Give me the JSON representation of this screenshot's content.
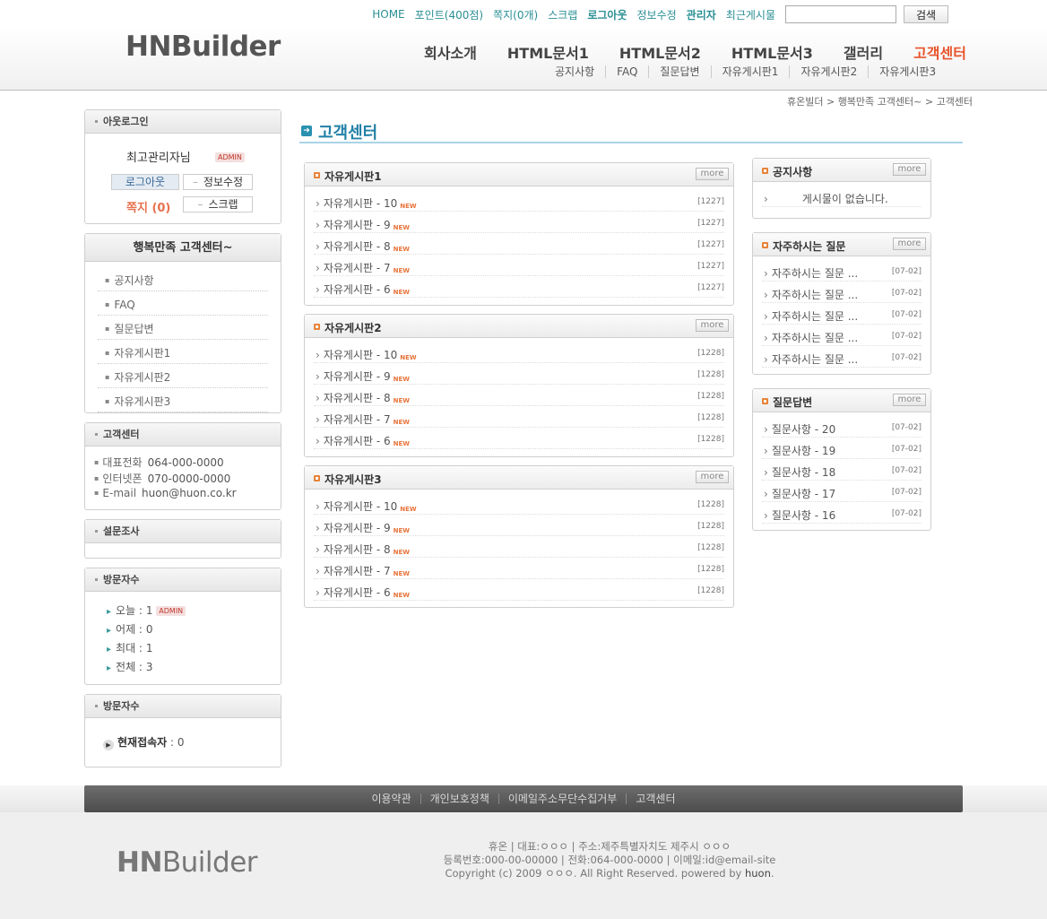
{
  "header": {
    "logo": "HNBuilder",
    "top_links": {
      "home": "HOME",
      "point": "포인트(400점)",
      "memo": "쪽지(0개)",
      "scrap": "스크랩",
      "logout": "로그아웃",
      "edit_info": "정보수정",
      "admin": "관리자",
      "recent": "최근게시물"
    },
    "search": {
      "value": "",
      "button": "검색"
    },
    "main_nav": [
      "회사소개",
      "HTML문서1",
      "HTML문서2",
      "HTML문서3",
      "갤러리",
      "고객센터"
    ],
    "sub_nav": [
      "공지사항",
      "FAQ",
      "질문답변",
      "자유게시판1",
      "자유게시판2",
      "자유게시판3"
    ]
  },
  "breadcrumb": "휴온빌더 > 행복만족 고객센터~ > 고객센터",
  "login_box": {
    "title": "아웃로그인",
    "user_name": "최고관리자님",
    "badge": "ADMIN",
    "logout": "로그아웃",
    "edit": "정보수정",
    "memo": "쪽지 (0)",
    "scrap": "스크랩"
  },
  "menu_box": {
    "title": "행복만족 고객센터~",
    "items": [
      "공지사항",
      "FAQ",
      "질문답변",
      "자유게시판1",
      "자유게시판2",
      "자유게시판3"
    ]
  },
  "contact_box": {
    "title": "고객센터",
    "rows": [
      {
        "label": "대표전화",
        "value": "064-000-0000"
      },
      {
        "label": "인터넷폰",
        "value": "070-0000-0000"
      },
      {
        "label": "E-mail",
        "value": "huon@huon.co.kr"
      }
    ]
  },
  "poll_box": {
    "title": "설문조사"
  },
  "visitor_box": {
    "title": "방문자수",
    "rows": [
      {
        "label": "오늘 :",
        "value": "1",
        "badge": "ADMIN"
      },
      {
        "label": "어제 :",
        "value": "0"
      },
      {
        "label": "최대 :",
        "value": "1"
      },
      {
        "label": "전체 :",
        "value": "3"
      }
    ]
  },
  "current_box": {
    "title": "방문자수",
    "label": "현재접속자",
    "value": ": 0"
  },
  "page_title": "고객센터",
  "more_label": "more",
  "new_label": "NEW",
  "boards": [
    {
      "title": "자유게시판1",
      "posts": [
        {
          "title": "자유게시판 - 10",
          "date": "[1227]"
        },
        {
          "title": "자유게시판 - 9",
          "date": "[1227]"
        },
        {
          "title": "자유게시판 - 8",
          "date": "[1227]"
        },
        {
          "title": "자유게시판 - 7",
          "date": "[1227]"
        },
        {
          "title": "자유게시판 - 6",
          "date": "[1227]"
        }
      ]
    },
    {
      "title": "자유게시판2",
      "posts": [
        {
          "title": "자유게시판 - 10",
          "date": "[1228]"
        },
        {
          "title": "자유게시판 - 9",
          "date": "[1228]"
        },
        {
          "title": "자유게시판 - 8",
          "date": "[1228]"
        },
        {
          "title": "자유게시판 - 7",
          "date": "[1228]"
        },
        {
          "title": "자유게시판 - 6",
          "date": "[1228]"
        }
      ]
    },
    {
      "title": "자유게시판3",
      "posts": [
        {
          "title": "자유게시판 - 10",
          "date": "[1228]"
        },
        {
          "title": "자유게시판 - 9",
          "date": "[1228]"
        },
        {
          "title": "자유게시판 - 8",
          "date": "[1228]"
        },
        {
          "title": "자유게시판 - 7",
          "date": "[1228]"
        },
        {
          "title": "자유게시판 - 6",
          "date": "[1228]"
        }
      ]
    }
  ],
  "side_boards": [
    {
      "title": "공지사항",
      "empty": "게시물이 없습니다."
    },
    {
      "title": "자주하시는 질문",
      "posts": [
        {
          "title": "자주하시는 질문 ...",
          "date": "[07-02]"
        },
        {
          "title": "자주하시는 질문 ...",
          "date": "[07-02]"
        },
        {
          "title": "자주하시는 질문 ...",
          "date": "[07-02]"
        },
        {
          "title": "자주하시는 질문 ...",
          "date": "[07-02]"
        },
        {
          "title": "자주하시는 질문 ...",
          "date": "[07-02]"
        }
      ]
    },
    {
      "title": "질문답변",
      "posts": [
        {
          "title": "질문사항 - 20",
          "date": "[07-02]"
        },
        {
          "title": "질문사항 - 19",
          "date": "[07-02]"
        },
        {
          "title": "질문사항 - 18",
          "date": "[07-02]"
        },
        {
          "title": "질문사항 - 17",
          "date": "[07-02]"
        },
        {
          "title": "질문사항 - 16",
          "date": "[07-02]"
        }
      ]
    }
  ],
  "footer": {
    "links": [
      "이용약관",
      "개인보호정책",
      "이메일주소무단수집거부",
      "고객센터"
    ],
    "logo_a": "HN",
    "logo_b": "Builder",
    "line1": "휴온 | 대표:ㅇㅇㅇ | 주소:제주특별자치도 제주시 ㅇㅇㅇ",
    "line2": "등록번호:000-00-00000 | 전화:064-000-0000 | 이메일:id@email-site",
    "line3": "Copyright (c) 2009 ㅇㅇㅇ. All Right Reserved. powered by ",
    "powered": "huon",
    "period": "."
  },
  "colors": {
    "accent": "#2180a6",
    "active_nav": "#e8532b",
    "top_link": "#2a8f94",
    "new": "#e8733a"
  }
}
